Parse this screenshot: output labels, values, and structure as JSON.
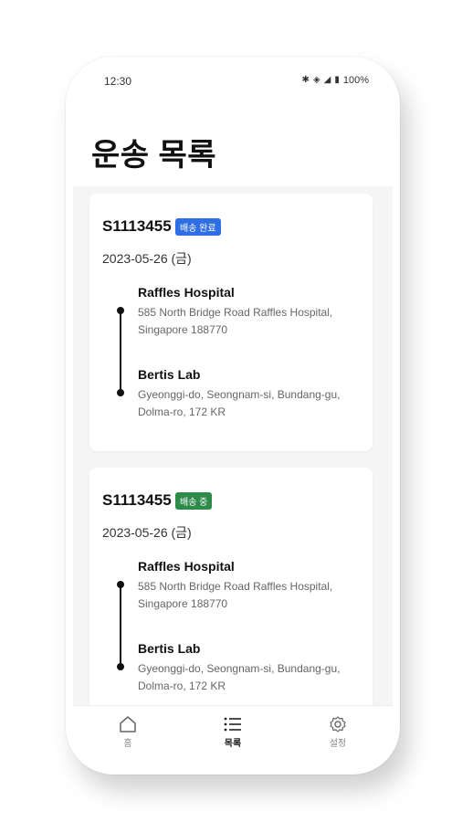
{
  "status_bar": {
    "time": "12:30",
    "battery": "100%"
  },
  "page": {
    "title": "운송 목록"
  },
  "shipments": [
    {
      "id": "S1113455",
      "status": "배송 완료",
      "status_color": "#2f6fe6",
      "date": "2023-05-26 (금)",
      "origin": {
        "name": "Raffles Hospital",
        "address": "585 North Bridge Road Raffles Hospital, Singapore 188770"
      },
      "destination": {
        "name": "Bertis Lab",
        "address": "Gyeonggi-do, Seongnam-si, Bundang-gu, Dolma-ro, 172 KR"
      }
    },
    {
      "id": "S1113455",
      "status": "배송 중",
      "status_color": "#2e8b4a",
      "date": "2023-05-26 (금)",
      "origin": {
        "name": "Raffles Hospital",
        "address": "585 North Bridge Road Raffles Hospital, Singapore 188770"
      },
      "destination": {
        "name": "Bertis Lab",
        "address": "Gyeonggi-do, Seongnam-si, Bundang-gu, Dolma-ro, 172 KR"
      }
    }
  ],
  "nav": {
    "items": [
      {
        "label": "홈",
        "icon": "home-icon"
      },
      {
        "label": "목록",
        "icon": "list-icon",
        "active": true
      },
      {
        "label": "설정",
        "icon": "gear-icon"
      }
    ]
  }
}
